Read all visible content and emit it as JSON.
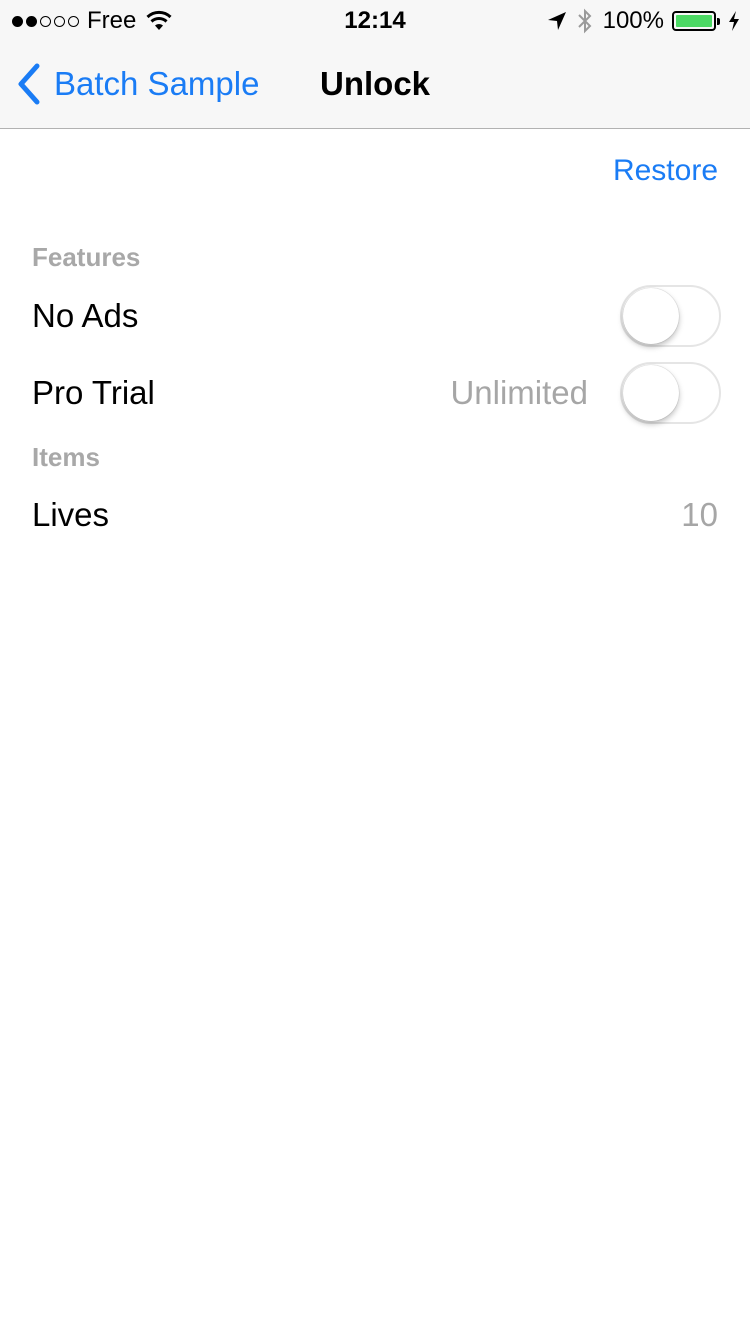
{
  "status_bar": {
    "carrier": "Free",
    "time": "12:14",
    "battery_percent": "100%",
    "battery_level": 1.0,
    "battery_color": "#4cd964",
    "signal_strength": 2,
    "signal_max": 5
  },
  "nav": {
    "back_label": "Batch Sample",
    "title": "Unlock",
    "tint_color": "#1a7cf5"
  },
  "restore_label": "Restore",
  "sections": {
    "features": {
      "header": "Features",
      "no_ads": {
        "label": "No Ads",
        "enabled": false
      },
      "pro_trial": {
        "label": "Pro Trial",
        "detail": "Unlimited",
        "enabled": false
      }
    },
    "items": {
      "header": "Items",
      "lives": {
        "label": "Lives",
        "value": "10"
      }
    }
  }
}
